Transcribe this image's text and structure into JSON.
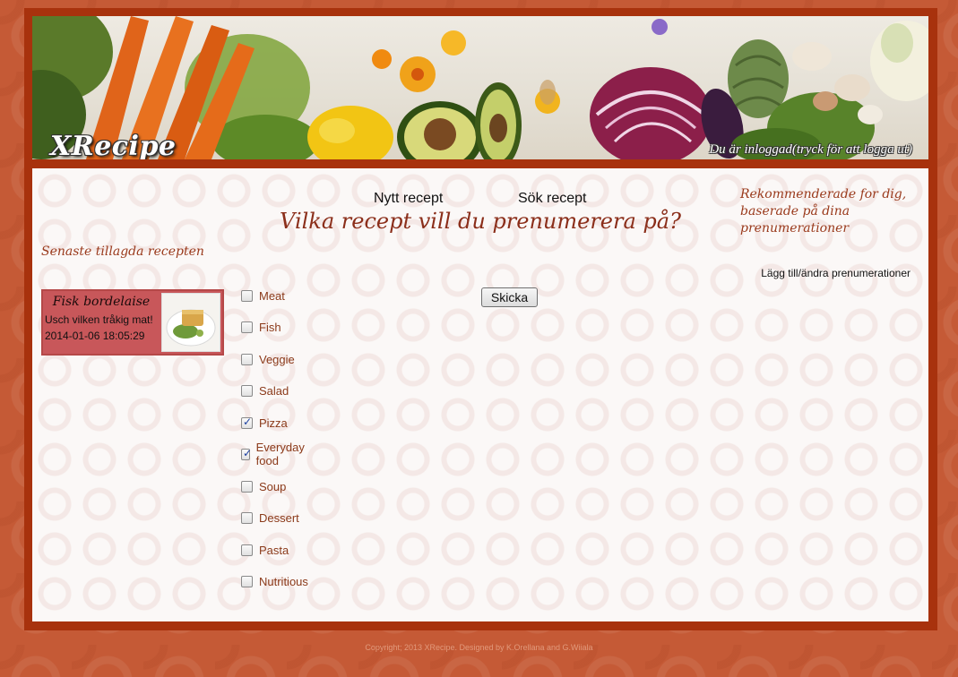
{
  "brand": {
    "name": "XRecipe",
    "logged_in_text": "Du är inloggad(tryck för att logga ut)"
  },
  "nav": {
    "new_recipe": "Nytt recept",
    "search_recipe": "Sök recept"
  },
  "main": {
    "title": "Vilka recept vill du prenumerera på?",
    "categories": [
      {
        "label": "Meat",
        "checked": false
      },
      {
        "label": "Fish",
        "checked": false
      },
      {
        "label": "Veggie",
        "checked": false
      },
      {
        "label": "Salad",
        "checked": false
      },
      {
        "label": "Pizza",
        "checked": true
      },
      {
        "label": "Everyday food",
        "checked": true
      },
      {
        "label": "Soup",
        "checked": false
      },
      {
        "label": "Dessert",
        "checked": false
      },
      {
        "label": "Pasta",
        "checked": false
      },
      {
        "label": "Nutritious",
        "checked": false
      }
    ],
    "submit_label": "Skicka"
  },
  "sidebar_left": {
    "heading": "Senaste tillagda recepten",
    "recipe": {
      "name": "Fisk bordelaise",
      "description": "Usch vilken tråkig mat!",
      "date": "2014-01-06 18:05:29"
    }
  },
  "sidebar_right": {
    "heading": "Rekommenderade for dig, baserade på dina prenumerationer",
    "link": "Lägg till/ändra prenumerationer"
  },
  "footer": {
    "text": "Copyright; 2013 XRecipe. Designed by K.Orellana and G.Wiiala"
  },
  "colors": {
    "accent": "#a8320d",
    "heading": "#8b2e1a",
    "card": "#c8575a"
  }
}
